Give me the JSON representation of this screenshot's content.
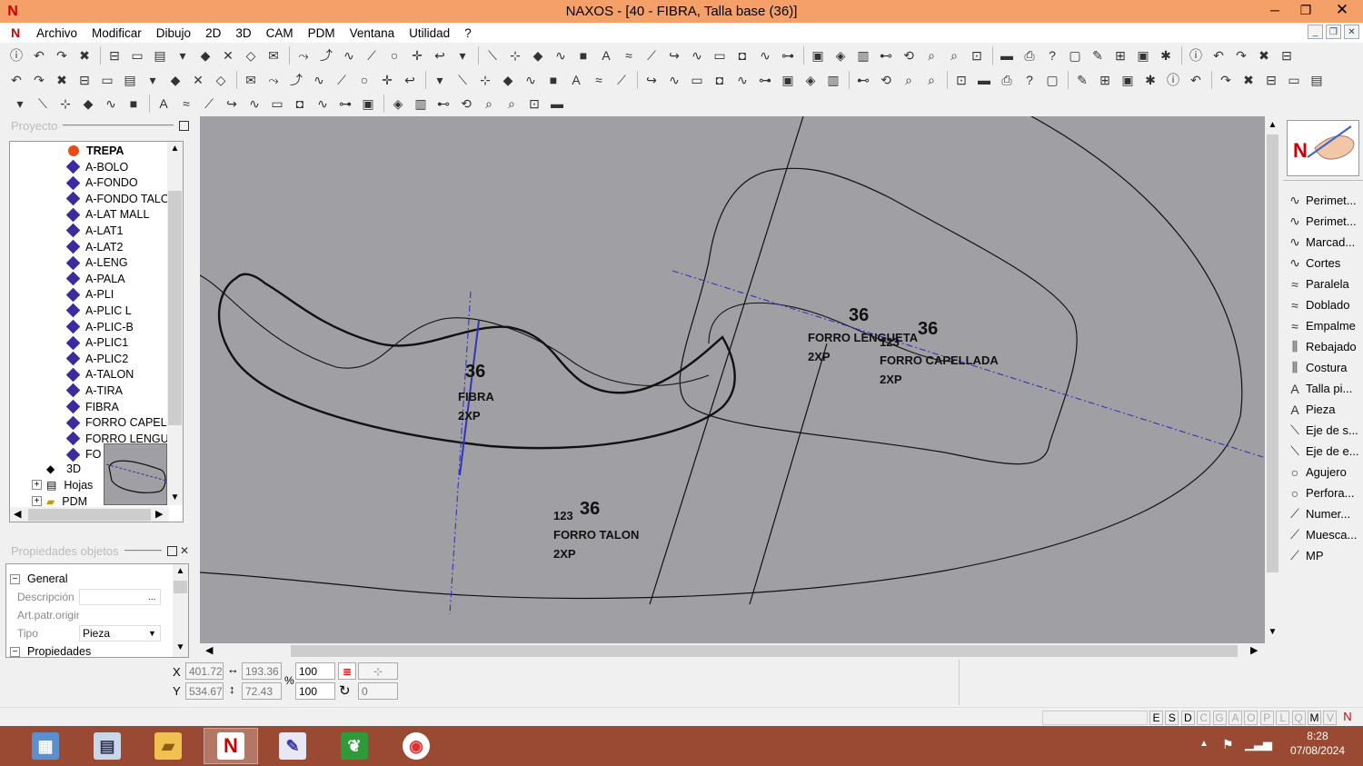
{
  "window": {
    "title": "NAXOS - [40 - FIBRA, Talla base (36)]",
    "logo_letter": "N",
    "minimize": "─",
    "maximize": "❐",
    "close": "✕"
  },
  "menu": {
    "items": [
      "Archivo",
      "Modificar",
      "Dibujo",
      "2D",
      "3D",
      "CAM",
      "PDM",
      "Ventana",
      "Utilidad",
      "?"
    ],
    "mdi_buttons": [
      "_",
      "❐",
      "✕"
    ]
  },
  "project_panel": {
    "header": "Proyecto",
    "root_item": "TREPA",
    "items": [
      "A-BOLO",
      "A-FONDO",
      "A-FONDO TALO",
      "A-LAT MALL",
      "A-LAT1",
      "A-LAT2",
      "A-LENG",
      "A-PALA",
      "A-PLI",
      "A-PLIC L",
      "A-PLIC-B",
      "A-PLIC1",
      "A-PLIC2",
      "A-TALON",
      "A-TIRA",
      "FIBRA",
      "FORRO CAPELL",
      "FORRO LENGU",
      "FO"
    ],
    "folders": [
      "3D",
      "Hojas",
      "PDM"
    ]
  },
  "properties_panel": {
    "header": "Propiedades objetos",
    "group_general": "General",
    "rows": [
      {
        "label": "Descripción",
        "value": ""
      },
      {
        "label": "Art.patr.origina",
        "value": ""
      },
      {
        "label": "Tipo",
        "value": "Pieza"
      }
    ],
    "group_props": "Propiedades"
  },
  "canvas": {
    "background": "#a0a0a4",
    "pieces": [
      {
        "size": "36",
        "name": "FIBRA",
        "qty": "2XP",
        "num": ""
      },
      {
        "size": "36",
        "name": "FORRO LENGUETA",
        "qty": "2XP",
        "num": ""
      },
      {
        "size": "36",
        "name": "FORRO CAPELLADA",
        "qty": "2XP",
        "num": "123"
      },
      {
        "size": "36",
        "name": "FORRO TALON",
        "qty": "2XP",
        "num": "123"
      }
    ]
  },
  "right_panel": {
    "items": [
      {
        "label": "Perimet...",
        "icon": "curve-icon"
      },
      {
        "label": "Perimet...",
        "icon": "curve-icon"
      },
      {
        "label": "Marcad...",
        "icon": "curve-icon"
      },
      {
        "label": "Cortes",
        "icon": "curve-icon"
      },
      {
        "label": "Paralela",
        "icon": "double-curve-icon"
      },
      {
        "label": "Doblado",
        "icon": "double-curve-icon"
      },
      {
        "label": "Empalme",
        "icon": "double-curve-icon"
      },
      {
        "label": "Rebajado",
        "icon": "stitch-icon"
      },
      {
        "label": "Costura",
        "icon": "stitch-icon"
      },
      {
        "label": "Talla pi...",
        "icon": "text-icon"
      },
      {
        "label": "Pieza",
        "icon": "text-icon"
      },
      {
        "label": "Eje de s...",
        "icon": "axis-icon"
      },
      {
        "label": "Eje de e...",
        "icon": "axis-icon"
      },
      {
        "label": "Agujero",
        "icon": "circle-icon"
      },
      {
        "label": "Perfora...",
        "icon": "circle-icon"
      },
      {
        "label": "Numer...",
        "icon": "pen-icon"
      },
      {
        "label": "Muesca...",
        "icon": "pen-icon"
      },
      {
        "label": "MP",
        "icon": "pen-icon"
      }
    ]
  },
  "coordinates": {
    "x_label": "X",
    "y_label": "Y",
    "x": "401.72",
    "y": "534.67",
    "width": "193.36",
    "height": "72.43",
    "percent_sign": "%",
    "scale_x": "100",
    "scale_y": "100",
    "rotation": "0"
  },
  "status": {
    "letters": [
      "E",
      "S",
      "D",
      "C",
      "G",
      "A",
      "O",
      "P",
      "L",
      "Q",
      "M",
      "V"
    ],
    "active_letters": [
      "E",
      "S",
      "D",
      "M"
    ]
  },
  "taskbar": {
    "time": "8:28",
    "date": "07/08/2024"
  }
}
